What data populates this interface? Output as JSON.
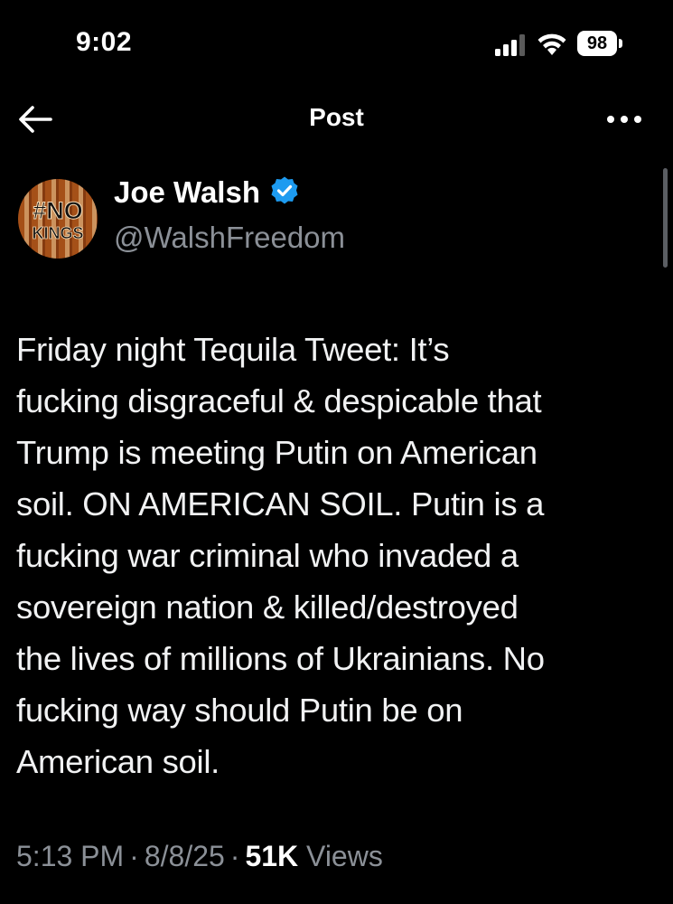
{
  "status_bar": {
    "time": "9:02",
    "battery": "98",
    "icons": [
      "signal-icon",
      "wifi-icon",
      "battery-icon"
    ]
  },
  "header": {
    "title": "Post",
    "back_icon": "arrow-left-icon",
    "more_icon": "more-horizontal-icon"
  },
  "author": {
    "name": "Joe Walsh",
    "handle": "@WalshFreedom",
    "verified": true,
    "avatar_text_top": "#NO",
    "avatar_text_bottom": "KINGS"
  },
  "post": {
    "text": "Friday night Tequila Tweet: It’s\nfucking disgraceful & despicable that\nTrump is meeting Putin on American\nsoil. ON AMERICAN SOIL. Putin is a\nfucking war criminal who invaded a\nsovereign nation &  killed/destroyed\nthe lives of millions of Ukrainians. No\nfucking way should Putin be on\nAmerican soil."
  },
  "meta": {
    "time": "5:13 PM",
    "separator": "·",
    "date": "8/8/25",
    "views_count": "51K",
    "views_label": "Views"
  },
  "colors": {
    "background": "#000000",
    "text": "#f1f2f3",
    "secondary": "#8b9097",
    "verified": "#1d9bf0"
  }
}
